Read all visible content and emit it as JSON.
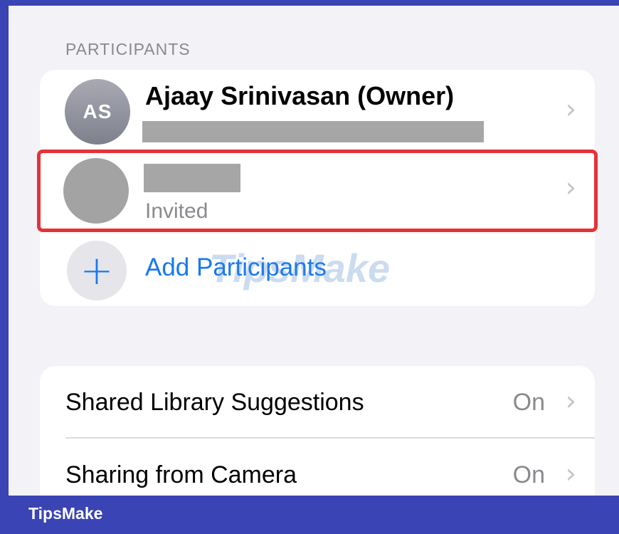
{
  "section": {
    "header": "PARTICIPANTS"
  },
  "participants": {
    "owner": {
      "initials": "AS",
      "name": "Ajaay Srinivasan (Owner)",
      "chevron": "›"
    },
    "invited": {
      "status": "Invited",
      "chevron": "›"
    },
    "add": {
      "label": "Add Participants",
      "icon": "+"
    }
  },
  "watermark": {
    "text": "TipsMake"
  },
  "settings": [
    {
      "title": "Shared Library Suggestions",
      "value": "On",
      "chevron": "›"
    },
    {
      "title": "Sharing from Camera",
      "value": "On",
      "chevron": "›"
    }
  ],
  "footer": {
    "brand": "TipsMake"
  },
  "colors": {
    "frame": "#3a44b4",
    "accent": "#1778f2",
    "highlight": "#e53238",
    "secondary_text": "#8a8a8e"
  }
}
